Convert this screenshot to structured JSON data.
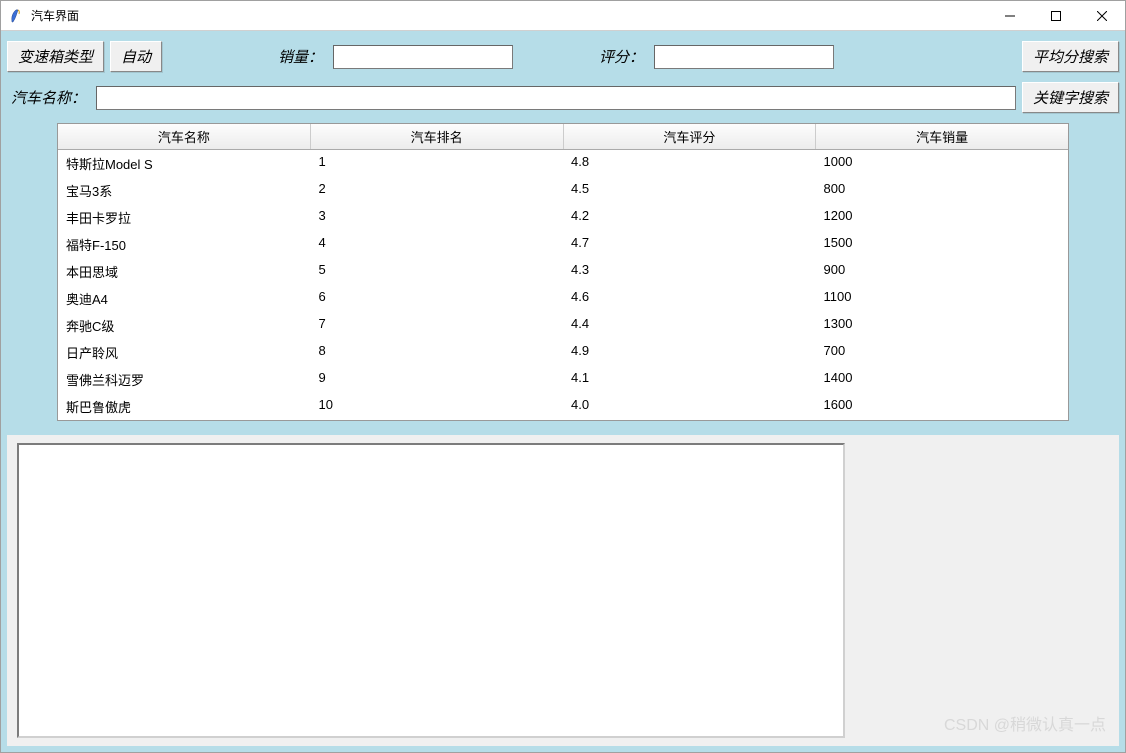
{
  "window": {
    "title": "汽车界面"
  },
  "toolbar": {
    "gearbox_type_label": "变速箱类型",
    "gearbox_auto_label": "自动",
    "sales_label": "销量：",
    "sales_value": "",
    "rating_label": "评分：",
    "rating_value": "",
    "avg_search_label": "平均分搜索",
    "car_name_label": "汽车名称：",
    "car_name_value": "",
    "keyword_search_label": "关键字搜索"
  },
  "table": {
    "headers": {
      "name": "汽车名称",
      "rank": "汽车排名",
      "rating": "汽车评分",
      "sales": "汽车销量"
    },
    "rows": [
      {
        "name": "特斯拉Model S",
        "rank": "1",
        "rating": "4.8",
        "sales": "1000"
      },
      {
        "name": "宝马3系",
        "rank": "2",
        "rating": "4.5",
        "sales": "800"
      },
      {
        "name": "丰田卡罗拉",
        "rank": "3",
        "rating": "4.2",
        "sales": "1200"
      },
      {
        "name": "福特F-150",
        "rank": "4",
        "rating": "4.7",
        "sales": "1500"
      },
      {
        "name": "本田思域",
        "rank": "5",
        "rating": "4.3",
        "sales": "900"
      },
      {
        "name": "奥迪A4",
        "rank": "6",
        "rating": "4.6",
        "sales": "1100"
      },
      {
        "name": "奔驰C级",
        "rank": "7",
        "rating": "4.4",
        "sales": "1300"
      },
      {
        "name": "日产聆风",
        "rank": "8",
        "rating": "4.9",
        "sales": "700"
      },
      {
        "name": "雪佛兰科迈罗",
        "rank": "9",
        "rating": "4.1",
        "sales": "1400"
      },
      {
        "name": "斯巴鲁傲虎",
        "rank": "10",
        "rating": "4.0",
        "sales": "1600"
      }
    ]
  },
  "watermark": "CSDN @稍微认真一点"
}
